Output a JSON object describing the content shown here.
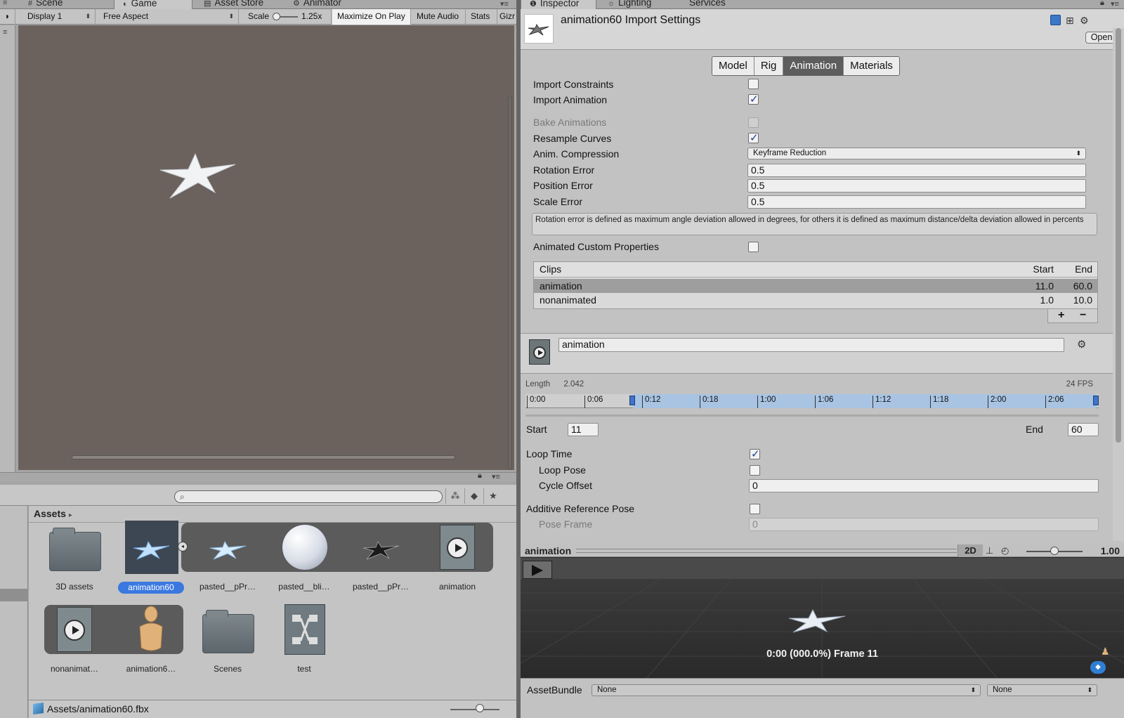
{
  "left_tabs": [
    "Scene",
    "Game",
    "Asset Store",
    "Animator"
  ],
  "game_toolbar": {
    "display": "Display 1",
    "aspect": "Free Aspect",
    "scale_label": "Scale",
    "scale_value": "1.25x",
    "maximize": "Maximize On Play",
    "mute": "Mute Audio",
    "stats": "Stats",
    "gizmos": "Gizr"
  },
  "project": {
    "search_placeholder": "",
    "breadcrumb": "Assets",
    "assets": [
      {
        "name": "3D assets",
        "type": "folder",
        "selected": false
      },
      {
        "name": "animation60",
        "type": "model",
        "selected": true
      },
      {
        "name": "pasted__pPr…",
        "type": "mesh",
        "selected": false
      },
      {
        "name": "pasted__bli…",
        "type": "material",
        "selected": false
      },
      {
        "name": "pasted__pPr…",
        "type": "mesh",
        "selected": false
      },
      {
        "name": "animation",
        "type": "clip",
        "selected": false
      },
      {
        "name": "nonanimat…",
        "type": "clip",
        "selected": false
      },
      {
        "name": "animation6…",
        "type": "avatar",
        "selected": false
      },
      {
        "name": "Scenes",
        "type": "folder",
        "selected": false
      },
      {
        "name": "test",
        "type": "controller",
        "selected": false
      }
    ],
    "path": "Assets/animation60.fbx"
  },
  "right_tabs": [
    "Inspector",
    "Lighting",
    "Services"
  ],
  "inspector": {
    "title": "animation60 Import Settings",
    "open_button": "Open",
    "tabs": [
      "Model",
      "Rig",
      "Animation",
      "Materials"
    ],
    "active_tab": "Animation",
    "import_constraints": "Import Constraints",
    "import_animation": "Import Animation",
    "bake_animations": "Bake Animations",
    "resample_curves": "Resample Curves",
    "anim_compression_label": "Anim. Compression",
    "anim_compression_value": "Keyframe Reduction",
    "rotation_error_label": "Rotation Error",
    "rotation_error": "0.5",
    "position_error_label": "Position Error",
    "position_error": "0.5",
    "scale_error_label": "Scale Error",
    "scale_error": "0.5",
    "help_text": "Rotation error is defined as maximum angle deviation allowed in degrees, for others it is defined as maximum distance/delta deviation allowed in percents",
    "custom_props": "Animated Custom Properties",
    "clips_header": {
      "name": "Clips",
      "start": "Start",
      "end": "End"
    },
    "clips": [
      {
        "name": "animation",
        "start": "11.0",
        "end": "60.0"
      },
      {
        "name": "nonanimated",
        "start": "1.0",
        "end": "10.0"
      }
    ],
    "add_label": "+",
    "remove_label": "−"
  },
  "clip": {
    "name": "animation",
    "length_label": "Length",
    "length": "2.042",
    "fps": "24 FPS",
    "ticks": [
      "0:00",
      "0:06",
      "0:12",
      "0:18",
      "1:00",
      "1:06",
      "1:12",
      "1:18",
      "2:00",
      "2:06"
    ],
    "start_label": "Start",
    "start": "11",
    "end_label": "End",
    "end": "60",
    "loop_time": "Loop Time",
    "loop_pose": "Loop Pose",
    "cycle_offset_label": "Cycle Offset",
    "cycle_offset": "0",
    "additive_ref": "Additive Reference Pose",
    "pose_frame_label": "Pose Frame",
    "pose_frame": "0"
  },
  "preview": {
    "title": "animation",
    "mode_2d": "2D",
    "zoom": "1.00",
    "frame_text": "0:00 (000.0%) Frame 11"
  },
  "asset_bundle": {
    "label": "AssetBundle",
    "bundle": "None",
    "variant": "None"
  }
}
